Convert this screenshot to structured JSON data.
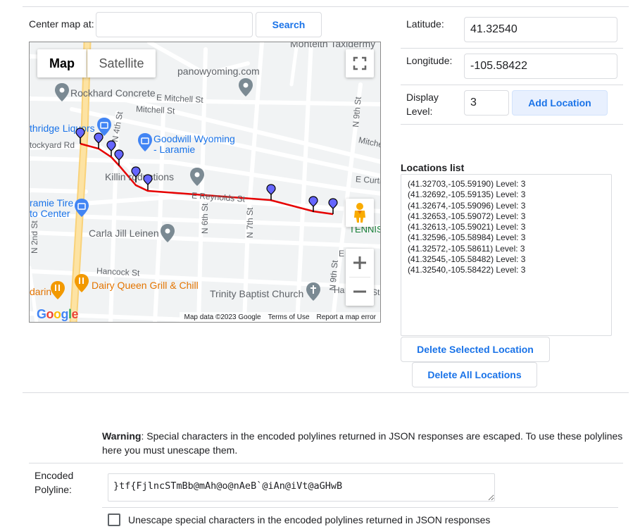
{
  "search": {
    "label": "Center map at:",
    "value": "",
    "placeholder": "",
    "button": "Search"
  },
  "map": {
    "type_buttons": [
      {
        "label": "Map",
        "selected": true
      },
      {
        "label": "Satellite",
        "selected": false
      }
    ],
    "labels": {
      "monteith": "Monteith Taxidermy",
      "panowyoming": "panowyoming.com",
      "rockhard": "Rockhard Concrete",
      "e_mitchell": "E Mitchell St",
      "mitchell": "Mitchell St",
      "mitchell_right": "Mitche",
      "liquors": "thridge Liquors",
      "stockyard": "tockyard Rd",
      "n4th": "N 4th St",
      "goodwill_1": "Goodwill Wyoming",
      "goodwill_2": "- Laramie",
      "killin": "Killin  roductions",
      "e_curtis": "E Curtis S",
      "laramie_tire_1": "ramie Tire",
      "laramie_tire_2": "to Center",
      "e_reynolds": "E Reynolds St",
      "n6th": "N 6th St",
      "n7th": "N 7th St",
      "n9th_top": "N 9th St",
      "n9th_bottom": "N 9th St",
      "n2nd": "N 2nd St",
      "carla": "Carla Jill Leinen",
      "tennis": "TENNIS",
      "hancock": "Hancock St",
      "e_small": "E",
      "mandarin": "darin",
      "dairy_queen": "Dairy Queen Grill & Chill",
      "trinity": "Trinity Baptist Church",
      "hancock_right": "Ha",
      "st_right": "St"
    },
    "logo": "Google",
    "attribution": {
      "data": "Map data ©2023 Google",
      "terms": "Terms of Use",
      "report": "Report a map error"
    },
    "colors": {
      "polyline": "#e60000",
      "marker": "#6666ff",
      "highway": "#fdd788"
    }
  },
  "form": {
    "latitude_label": "Latitude:",
    "latitude_value": "41.32540",
    "longitude_label": "Longitude:",
    "longitude_value": "-105.58422",
    "display_level_label_1": "Display",
    "display_level_label_2": "Level:",
    "display_level_value": "3",
    "add_button": "Add Location"
  },
  "locations": {
    "title": "Locations list",
    "items": [
      "(41.32703,-105.59190) Level: 3",
      "(41.32692,-105.59135) Level: 3",
      "(41.32674,-105.59096) Level: 3",
      "(41.32653,-105.59072) Level: 3",
      "(41.32613,-105.59021) Level: 3",
      "(41.32596,-105.58984) Level: 3",
      "(41.32572,-105.58611) Level: 3",
      "(41.32545,-105.58482) Level: 3",
      "(41.32540,-105.58422) Level: 3"
    ],
    "delete_selected": "Delete Selected Location",
    "delete_all": "Delete All Locations"
  },
  "warning": {
    "bold": "Warning",
    "text": ": Special characters in the encoded polylines returned in JSON responses are escaped. To use these polylines here you must unescape them."
  },
  "polyline": {
    "label_1": "Encoded",
    "label_2": "Polyline:",
    "value": "}tf{FjlncSTmBb@mAh@o@nAeB`@iAn@iVt@aGHwB"
  },
  "unescape": {
    "label": "Unescape special characters in the encoded polylines returned in JSON responses",
    "checked": false
  }
}
